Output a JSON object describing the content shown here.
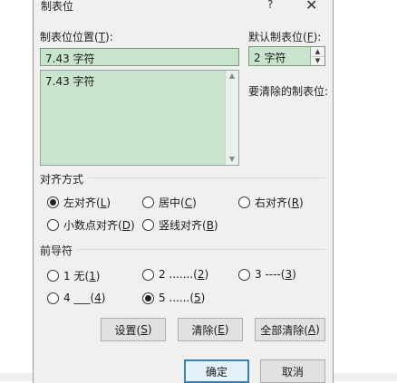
{
  "dialog": {
    "title": "制表位",
    "help": "?",
    "close": "✕"
  },
  "tab_stop": {
    "label": "制表位位置(",
    "label_key": "T",
    "label_end": "):",
    "input_value": "7.43 字符",
    "list_items": [
      "7.43 字符"
    ]
  },
  "default_tab": {
    "label": "默认制表位(",
    "label_key": "F",
    "label_end": "):",
    "value": "2 字符"
  },
  "to_clear_label": "要清除的制表位:",
  "alignment": {
    "heading": "对齐方式",
    "options": [
      {
        "text": "左对齐(",
        "key": "L",
        "end": ")",
        "checked": true
      },
      {
        "text": "居中(",
        "key": "C",
        "end": ")",
        "checked": false
      },
      {
        "text": "右对齐(",
        "key": "R",
        "end": ")",
        "checked": false
      },
      {
        "text": "小数点对齐(",
        "key": "D",
        "end": ")",
        "checked": false
      },
      {
        "text": "竖线对齐(",
        "key": "B",
        "end": ")",
        "checked": false
      }
    ]
  },
  "leader": {
    "heading": "前导符",
    "options": [
      {
        "text": "1 无(",
        "key": "1",
        "end": ")",
        "checked": false
      },
      {
        "text": "2 .......(",
        "key": "2",
        "end": ")",
        "checked": false
      },
      {
        "text": "3 ----(",
        "key": "3",
        "end": ")",
        "checked": false
      },
      {
        "text": "4 ___(",
        "key": "4",
        "end": ")",
        "checked": false
      },
      {
        "text": "5 ......(",
        "key": "5",
        "end": ")",
        "checked": true
      }
    ]
  },
  "buttons": {
    "set": {
      "text": "设置(",
      "key": "S",
      "end": ")"
    },
    "clear": {
      "text": "清除(",
      "key": "E",
      "end": ")"
    },
    "clear_all": {
      "text": "全部清除(",
      "key": "A",
      "end": ")"
    },
    "ok": "确定",
    "cancel": "取消"
  }
}
